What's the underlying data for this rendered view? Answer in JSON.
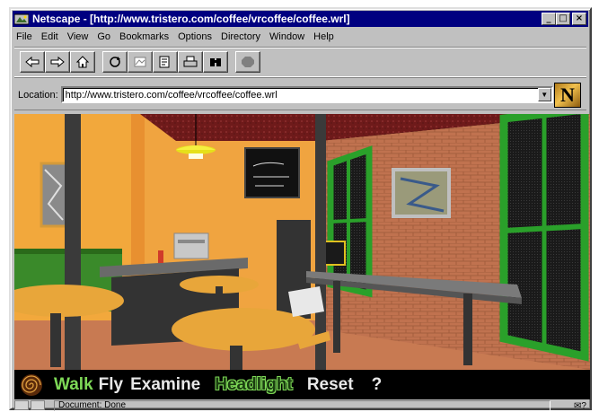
{
  "window": {
    "title": "Netscape - [http://www.tristero.com/coffee/vrcoffee/coffee.wrl]",
    "minimize_glyph": "_",
    "maximize_glyph": "□",
    "close_glyph": "×"
  },
  "menu": [
    "File",
    "Edit",
    "View",
    "Go",
    "Bookmarks",
    "Options",
    "Directory",
    "Window",
    "Help"
  ],
  "toolbar": {
    "buttons": [
      "back-icon",
      "forward-icon",
      "home-icon",
      "reload-icon",
      "images-icon",
      "open-icon",
      "print-icon",
      "find-icon",
      "stop-icon"
    ]
  },
  "location": {
    "label": "Location:",
    "url": "http://www.tristero.com/coffee/vrcoffee/coffee.wrl",
    "logo_letter": "N"
  },
  "vrml": {
    "walk": "Walk",
    "fly": "Fly",
    "examine": "Examine",
    "headlight": "Headlight",
    "reset": "Reset",
    "help": "?"
  },
  "status": {
    "text": "Document: Done",
    "mail_glyph": "✉?"
  }
}
